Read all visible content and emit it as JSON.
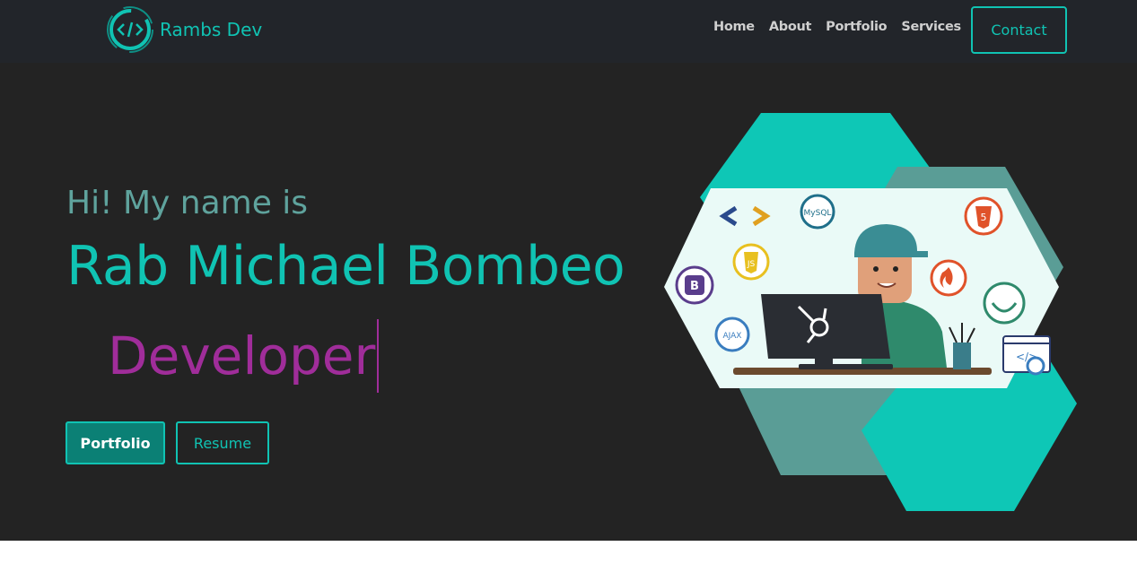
{
  "brand": {
    "name": "Rambs Dev",
    "logo_icon": "code-brackets-logo"
  },
  "nav": {
    "links": [
      "Home",
      "About",
      "Portfolio",
      "Services"
    ],
    "contact_label": "Contact"
  },
  "hero": {
    "greeting": "Hi! My name is",
    "name": "Rab Michael Bombeo",
    "role": "Developer",
    "buttons": {
      "primary": "Portfolio",
      "secondary": "Resume"
    }
  },
  "illustration": {
    "icons": [
      "code-arrows-icon",
      "mysql-icon",
      "html5-icon",
      "js-icon",
      "codeigniter-icon",
      "bootstrap-icon",
      "jquery-icon",
      "ajax-icon",
      "hubspot-icon",
      "web-settings-icon"
    ],
    "icon_labels": {
      "mysql": "MySQL",
      "ajax": "AJAX",
      "js": "JS"
    }
  },
  "colors": {
    "nav_bg": "#22252a",
    "hero_bg": "#232323",
    "accent": "#10c3b3",
    "accent_muted": "#5fa39d",
    "role": "#a02d9a"
  }
}
